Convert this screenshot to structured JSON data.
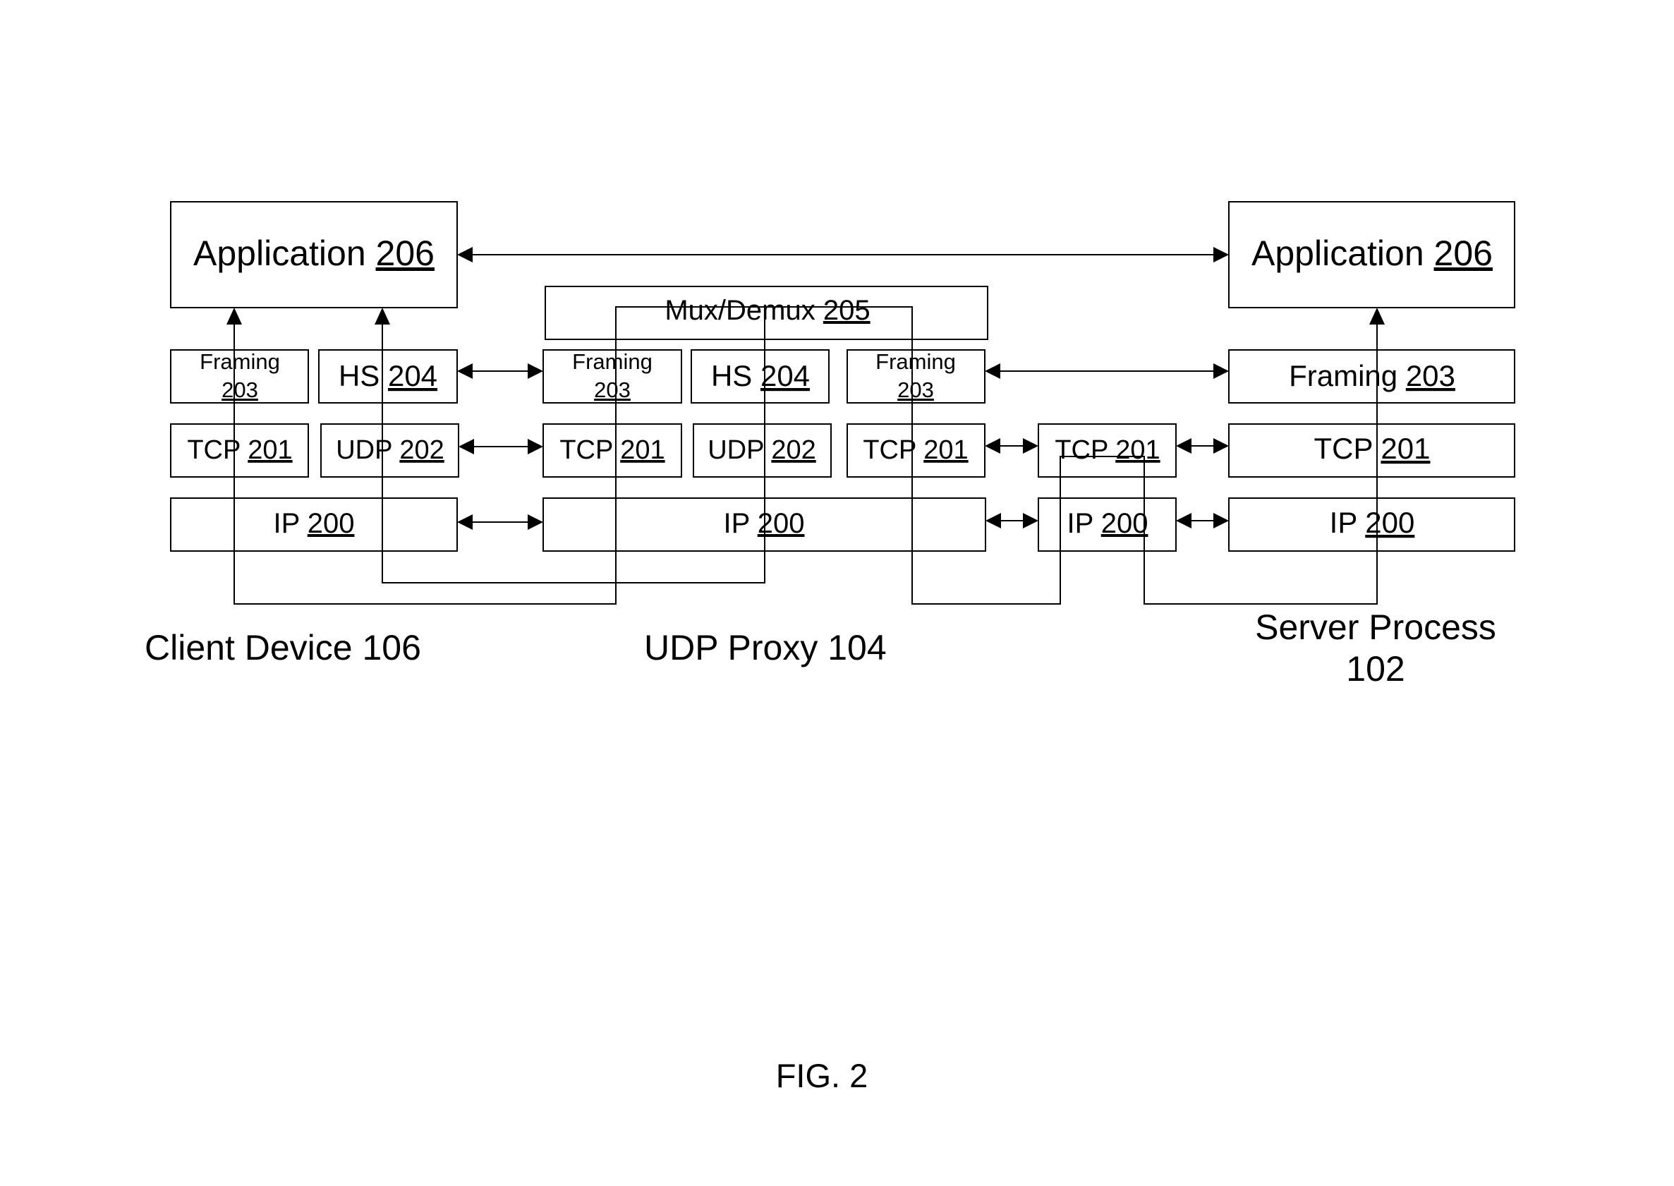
{
  "figure": {
    "caption": "FIG. 2",
    "groups": {
      "client": "Client Device 106",
      "proxy": "UDP Proxy 104",
      "server_line1": "Server Process",
      "server_line2": "102"
    },
    "client_device": {
      "application": {
        "name": "Application",
        "ref": "206"
      },
      "framing": {
        "name": "Framing",
        "ref": "203"
      },
      "hs": {
        "name": "HS",
        "ref": "204"
      },
      "tcp": {
        "name": "TCP",
        "ref": "201"
      },
      "udp": {
        "name": "UDP",
        "ref": "202"
      },
      "ip": {
        "name": "IP",
        "ref": "200"
      }
    },
    "udp_proxy": {
      "muxdemux": {
        "name": "Mux/Demux",
        "ref": "205"
      },
      "framing_a": {
        "name": "Framing",
        "ref": "203"
      },
      "hs": {
        "name": "HS",
        "ref": "204"
      },
      "framing_b": {
        "name": "Framing",
        "ref": "203"
      },
      "tcp_a": {
        "name": "TCP",
        "ref": "201"
      },
      "udp": {
        "name": "UDP",
        "ref": "202"
      },
      "tcp_b": {
        "name": "TCP",
        "ref": "201"
      },
      "ip": {
        "name": "IP",
        "ref": "200"
      }
    },
    "intermediate": {
      "tcp": {
        "name": "TCP",
        "ref": "201"
      },
      "ip": {
        "name": "IP",
        "ref": "200"
      }
    },
    "server_process": {
      "application": {
        "name": "Application",
        "ref": "206"
      },
      "framing": {
        "name": "Framing",
        "ref": "203"
      },
      "tcp": {
        "name": "TCP",
        "ref": "201"
      },
      "ip": {
        "name": "IP",
        "ref": "200"
      }
    },
    "connections": [
      {
        "from": "client_device.application",
        "to": "server_process.application",
        "type": "bidirectional"
      },
      {
        "from": "client_device.hs",
        "to": "udp_proxy.framing_a",
        "type": "bidirectional"
      },
      {
        "from": "udp_proxy.framing_b",
        "to": "server_process.framing",
        "type": "bidirectional"
      },
      {
        "from": "client_device.udp",
        "to": "udp_proxy.tcp_a",
        "type": "bidirectional"
      },
      {
        "from": "udp_proxy.tcp_b",
        "to": "intermediate.tcp",
        "type": "bidirectional"
      },
      {
        "from": "intermediate.tcp",
        "to": "server_process.tcp",
        "type": "bidirectional"
      },
      {
        "from": "client_device.ip",
        "to": "udp_proxy.ip",
        "type": "bidirectional"
      },
      {
        "from": "udp_proxy.ip",
        "to": "intermediate.ip",
        "type": "bidirectional"
      },
      {
        "from": "intermediate.ip",
        "to": "server_process.ip",
        "type": "bidirectional"
      },
      {
        "from": "data-path-1",
        "to": "client_device.application",
        "type": "directed"
      },
      {
        "from": "data-path-2",
        "to": "client_device.application",
        "type": "directed"
      },
      {
        "from": "data-path-1",
        "to": "server_process.application",
        "type": "directed"
      }
    ]
  }
}
